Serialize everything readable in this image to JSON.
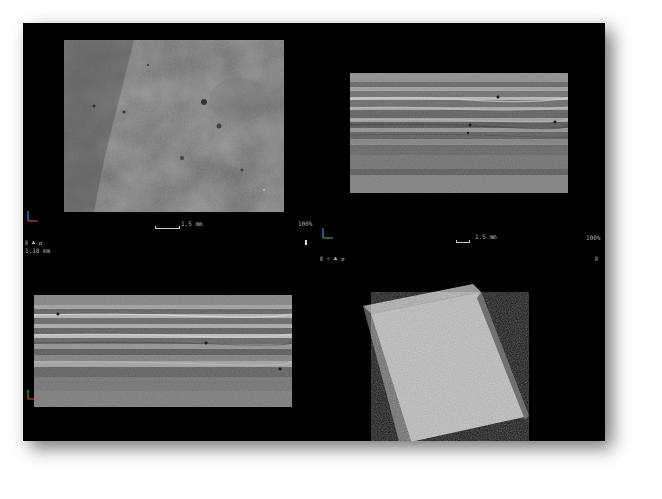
{
  "viewports": {
    "top_left": {
      "view": "top",
      "scale_label": "1.5 mm",
      "info_line1": "Ⅱ ♣ ⇄",
      "info_line2": "1.18 mm",
      "zoom": "100%"
    },
    "top_right": {
      "view": "side",
      "scale_label": "1.5 mm",
      "info_line1": "Ⅱ ☼ ♣ ⇄",
      "zoom": "100%",
      "corner": "Ⅱ"
    },
    "bottom_left": {
      "view": "front"
    },
    "bottom_right": {
      "view": "3d-volume"
    }
  },
  "colors": {
    "background": "#000000",
    "frame": "#ffffff",
    "axis_x": "#e05050",
    "axis_y": "#50c050",
    "axis_z": "#5080ff"
  },
  "icons": [
    "axis-triad-icon",
    "scale-bar-icon",
    "3d-volume-cube"
  ]
}
